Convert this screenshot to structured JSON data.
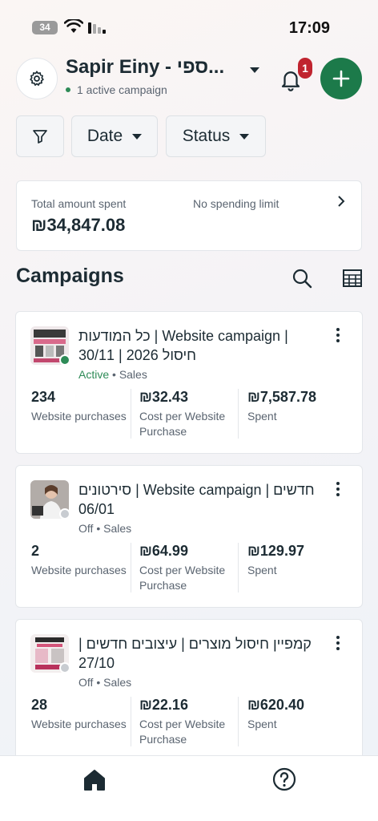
{
  "status_bar": {
    "battery": "34",
    "time": "17:09"
  },
  "header": {
    "account_name": "Sapir Einy - ספי...",
    "active_campaigns": "1 active campaign",
    "notification_count": "1"
  },
  "filters": {
    "date_label": "Date",
    "status_label": "Status"
  },
  "spend": {
    "label": "Total amount spent",
    "limit": "No spending limit",
    "amount": "₪34,847.08"
  },
  "campaigns_section": {
    "title": "Campaigns"
  },
  "campaigns": [
    {
      "title": "כל המודעות | Website campaign | חיסול 2026 | 30/11",
      "state": "Active",
      "objective": "Sales",
      "metrics": [
        {
          "value": "234",
          "label": "Website purchases"
        },
        {
          "value": "₪32.43",
          "label": "Cost per Website Purchase"
        },
        {
          "value": "₪7,587.78",
          "label": "Spent"
        }
      ]
    },
    {
      "title": "סירטונים | Website campaign | חדשים 06/01",
      "state": "Off",
      "objective": "Sales",
      "metrics": [
        {
          "value": "2",
          "label": "Website purchases"
        },
        {
          "value": "₪64.99",
          "label": "Cost per Website Purchase"
        },
        {
          "value": "₪129.97",
          "label": "Spent"
        }
      ]
    },
    {
      "title": "קמפיין חיסול מוצרים | עיצובים חדשים | 27/10",
      "state": "Off",
      "objective": "Sales",
      "metrics": [
        {
          "value": "28",
          "label": "Website purchases"
        },
        {
          "value": "₪22.16",
          "label": "Cost per Website Purchase"
        },
        {
          "value": "₪620.40",
          "label": "Spent"
        }
      ]
    }
  ],
  "colors": {
    "accent_green": "#1c7a4a",
    "active_green": "#2e8b57",
    "badge_red": "#c0242f",
    "text_primary": "#1c2b33",
    "text_secondary": "#5a6470"
  },
  "icons": {
    "settings": "gear-icon",
    "bell": "bell-icon",
    "add": "plus-icon",
    "filter": "filter-icon",
    "search": "search-icon",
    "table": "table-icon",
    "home": "home-icon",
    "help": "help-icon"
  }
}
